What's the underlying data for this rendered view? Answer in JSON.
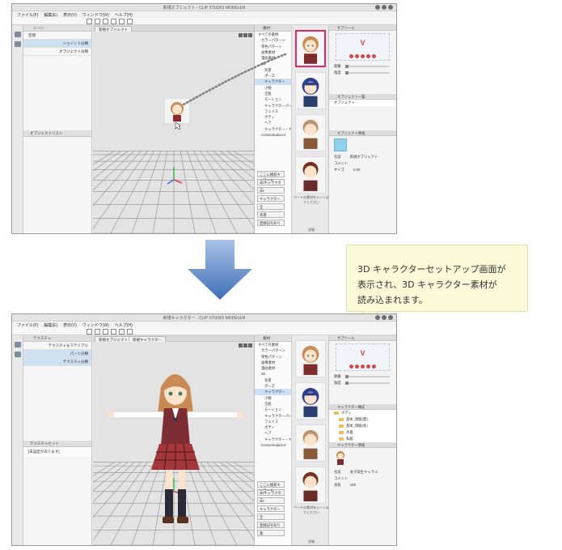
{
  "callout": {
    "text_line1": "3D キャラクターセットアップ画面が",
    "text_line2": "表示され、3D キャラクター素材が",
    "text_line3": "読み込まれます。"
  },
  "app": {
    "menu": [
      "ファイル(F)",
      "編集(E)",
      "表示(V)",
      "ウィンドウ(W)",
      "ヘルプ(H)"
    ]
  },
  "screen1": {
    "title": "新規オブジェクト - CLIP STUDIO MODELER",
    "canvas_tab": "新規オブジェクト",
    "left_panel_header": "シーン",
    "left_rows": [
      {
        "label": "空間",
        "right": ""
      },
      {
        "label": "",
        "right": "ジョイント分類"
      },
      {
        "label": "",
        "right": "オブジェクト分類"
      }
    ],
    "lower_header": "オブジェクトリスト",
    "tree_header": "素材",
    "tree_items": [
      "すべての素材",
      "カラーパターン",
      "単色パターン",
      "画像素材",
      "漫画素材",
      "3D",
      "背景",
      "ポーズ",
      "キャラクター",
      "小物",
      "全般",
      "モーション",
      "キャラクターパーツ",
      "フェイス",
      "ボディ",
      "ヘア",
      "キャラクター・ヤング",
      "ComicStudio4.0"
    ],
    "tree_selected": "キャラクター",
    "tree_tools": [
      "ここに検索キーワード",
      "3Dキャラクター",
      "3D",
      "キャラクター",
      "全",
      "背景",
      "登録記号あり",
      "素"
    ],
    "thumb_note": "ワードの素材をシーンまでください",
    "bottom_label": "詳細",
    "right_header1": "サブツール",
    "right_rows1": [
      "距離",
      "角度"
    ],
    "right_header2": "オブジェクト一覧",
    "right_rows2": [
      "オブジェクト"
    ],
    "right_header3": "オブジェクト情報",
    "props": [
      {
        "label": "名前",
        "value": "新規オブジェクト"
      },
      {
        "label": "コメント",
        "value": ""
      },
      {
        "label": "サイズ",
        "value": "0.00"
      }
    ]
  },
  "screen2": {
    "title": "新規キャラクター - CLIP STUDIO MODELER",
    "canvas_tabs": [
      "新規オブジェクト",
      "新規キャラクター"
    ],
    "left_panel_header": "テクスチャ",
    "left_rows": [
      {
        "label": "",
        "right": "テクスチャ＆マテリアル"
      },
      {
        "label": "",
        "right": "パーツ分類"
      },
      {
        "label": "",
        "right": "テクスチャ分類"
      }
    ],
    "lower_header": "テクスチャセット",
    "lower_body": "[未設定があります]",
    "right_header2": "キャラクター構成",
    "tree_rows": [
      "ボディ",
      "基本_制服(夏)",
      "基本_制服(冬)",
      "水着",
      "私服"
    ],
    "right_header3": "キャラクター情報",
    "props": [
      {
        "label": "名前",
        "value": "女子高生キャラ-3"
      },
      {
        "label": "コメント",
        "value": ""
      },
      {
        "label": "身長",
        "value": "160"
      }
    ]
  },
  "colors": {
    "highlight": "#e0286a",
    "arrow": "#4a79c0",
    "callout_bg": "#fafad9"
  }
}
